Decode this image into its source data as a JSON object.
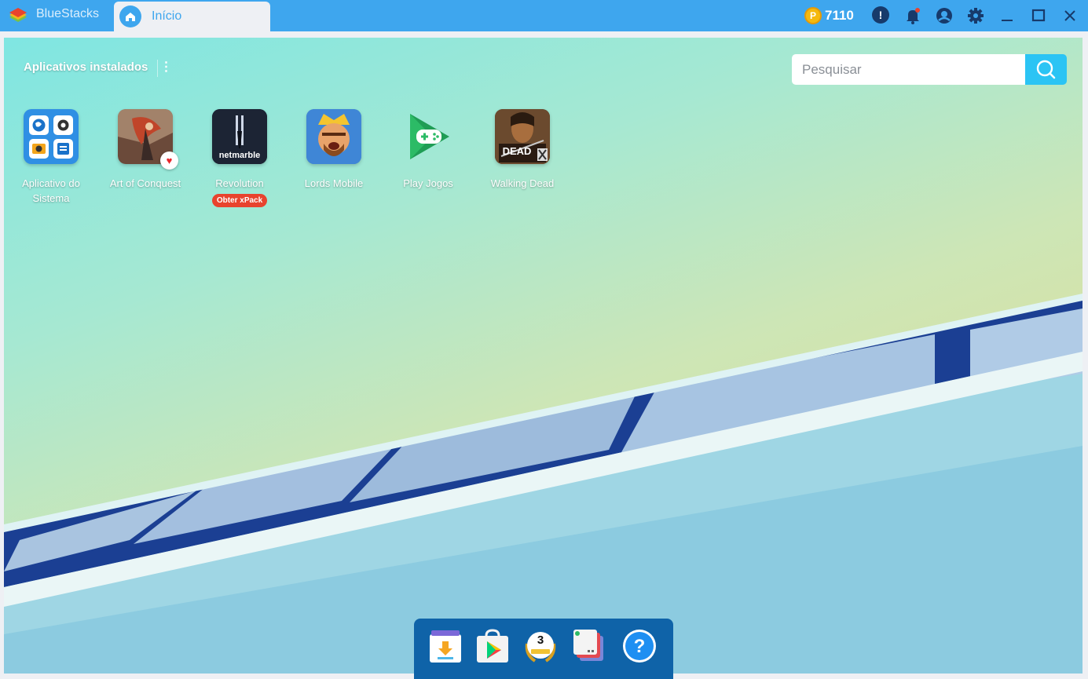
{
  "titlebar": {
    "app_name": "BlueStacks",
    "tab_label": "Início",
    "coins": "7110",
    "coin_symbol": "P"
  },
  "main": {
    "section_title": "Aplicativos instalados",
    "menu_glyph": "⋮",
    "search_placeholder": "Pesquisar",
    "apps": [
      {
        "name": "Aplicativo do Sistema"
      },
      {
        "name": "Art of Conquest"
      },
      {
        "name": "Revolution",
        "badge": "Obter xPack",
        "icon_text": "netmarble"
      },
      {
        "name": "Lords Mobile"
      },
      {
        "name": "Play Jogos"
      },
      {
        "name": "Walking Dead",
        "icon_text": "DEAD"
      }
    ]
  },
  "dock": {
    "level": "3",
    "help_glyph": "?"
  },
  "colors": {
    "titlebar": "#3ea6ee",
    "search_button": "#2bc4f4",
    "dock": "#0f63a8",
    "badge": "#e8432e"
  }
}
